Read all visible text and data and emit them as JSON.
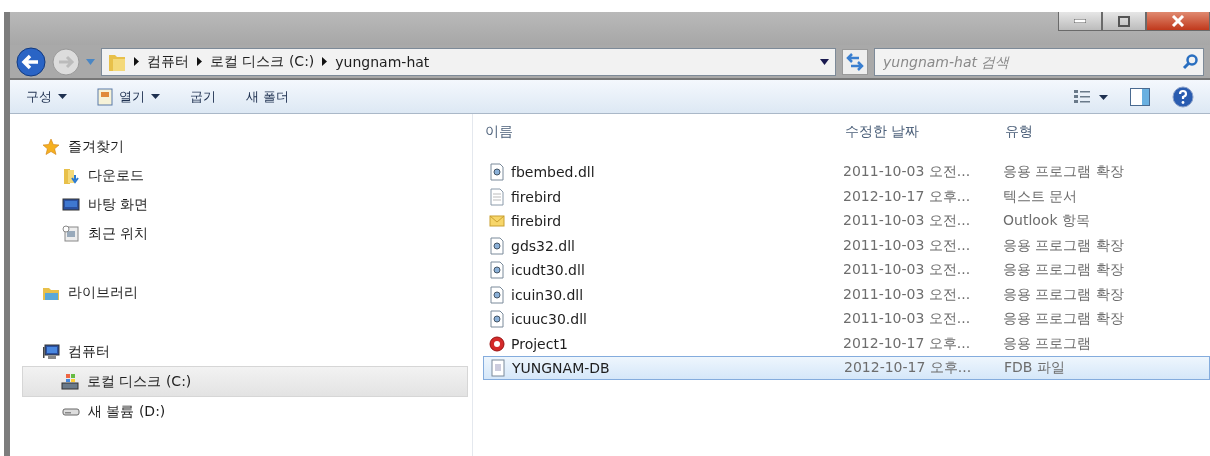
{
  "window": {
    "controls": [
      {
        "kind": "minimize"
      },
      {
        "kind": "maximize"
      },
      {
        "kind": "close"
      }
    ]
  },
  "address_bar": {
    "segments": [
      "컴퓨터",
      "로컬 디스크 (C:)",
      "yungnam-hat"
    ]
  },
  "search": {
    "placeholder": "yungnam-hat 검색"
  },
  "toolbar": {
    "items": [
      {
        "label": "구성",
        "dropdown": true,
        "kind": "plain"
      },
      {
        "label": "열기",
        "dropdown": true,
        "kind": "open"
      },
      {
        "label": "굽기",
        "dropdown": false,
        "kind": "plain"
      },
      {
        "label": "새 폴더",
        "dropdown": false,
        "kind": "plain"
      }
    ]
  },
  "sidebar": {
    "groups": [
      {
        "label": "즐겨찾기",
        "kind": "star",
        "children": [
          {
            "label": "다운로드",
            "kind": "download",
            "selected": false
          },
          {
            "label": "바탕 화면",
            "kind": "desktop",
            "selected": false
          },
          {
            "label": "최근 위치",
            "kind": "recent",
            "selected": false
          }
        ]
      },
      {
        "label": "라이브러리",
        "kind": "library"
      },
      {
        "label": "컴퓨터",
        "kind": "computer",
        "children": [
          {
            "label": "로컬 디스크 (C:)",
            "kind": "disk",
            "selected": true
          },
          {
            "label": "새 볼륨 (D:)",
            "kind": "drive",
            "selected": false
          }
        ]
      }
    ]
  },
  "table": {
    "columns": [
      "이름",
      "수정한 날짜",
      "유형"
    ],
    "rows": [
      {
        "name": "fbembed.dll",
        "date": "2011-10-03 오전...",
        "type": "응용 프로그램 확장",
        "kind": "dll",
        "selected": false
      },
      {
        "name": "firebird",
        "date": "2012-10-17 오후...",
        "type": "텍스트 문서",
        "kind": "text",
        "selected": false
      },
      {
        "name": "firebird",
        "date": "2011-10-03 오전...",
        "type": "Outlook 항목",
        "kind": "mail",
        "selected": false
      },
      {
        "name": "gds32.dll",
        "date": "2011-10-03 오전...",
        "type": "응용 프로그램 확장",
        "kind": "dll",
        "selected": false
      },
      {
        "name": "icudt30.dll",
        "date": "2011-10-03 오전...",
        "type": "응용 프로그램 확장",
        "kind": "dll",
        "selected": false
      },
      {
        "name": "icuin30.dll",
        "date": "2011-10-03 오전...",
        "type": "응용 프로그램 확장",
        "kind": "dll",
        "selected": false
      },
      {
        "name": "icuuc30.dll",
        "date": "2011-10-03 오전...",
        "type": "응용 프로그램 확장",
        "kind": "dll",
        "selected": false
      },
      {
        "name": "Project1",
        "date": "2012-10-17 오후...",
        "type": "응용 프로그램",
        "kind": "app",
        "selected": false
      },
      {
        "name": "YUNGNAM-DB",
        "date": "2012-10-17 오후...",
        "type": "FDB 파일",
        "kind": "db",
        "selected": true
      }
    ]
  }
}
